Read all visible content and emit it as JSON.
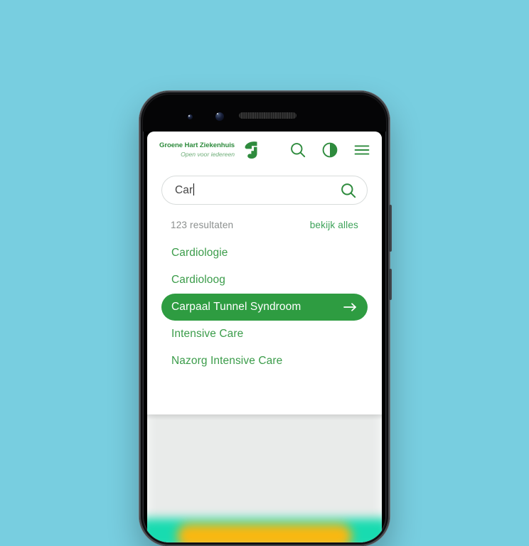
{
  "background": {
    "color": "#78cee0"
  },
  "device": {
    "name": "smartphone-mockup",
    "frame_color": "#1b1b1d",
    "buttons": [
      "volume-rocker",
      "power-button"
    ],
    "front_elements": [
      "camera-lens-small",
      "camera-lens-large",
      "earpiece-speaker"
    ]
  },
  "app": {
    "header": {
      "brand": {
        "name": "Groene Hart Ziekenhuis",
        "tagline": "Open voor iedereen",
        "mark_icon": "logo-mark-icon",
        "color": "#2e8b3d"
      },
      "actions": [
        {
          "icon": "search-icon",
          "label": "Zoeken"
        },
        {
          "icon": "contrast-icon",
          "label": "Contrast"
        },
        {
          "icon": "hamburger-menu-icon",
          "label": "Menu"
        }
      ]
    },
    "search": {
      "value": "Car",
      "placeholder": "Zoeken",
      "submit_icon": "search-icon",
      "has_caret": true
    },
    "results": {
      "count_label": "123 resultaten",
      "view_all_label": "bekijk alles",
      "accent_color": "#3ea35a",
      "items": [
        {
          "label": "Cardiologie",
          "selected": false
        },
        {
          "label": "Cardioloog",
          "selected": false
        },
        {
          "label": "Carpaal Tunnel Syndroom",
          "selected": true,
          "arrow_icon": "arrow-right-icon"
        },
        {
          "label": "Intensive Care",
          "selected": false
        },
        {
          "label": "Nazorg Intensive Care",
          "selected": false
        }
      ]
    },
    "background_page": {
      "state": "blurred",
      "card_color": "#f1f3f2",
      "band_color": "#18dbb0",
      "cta_color": "#f9b811"
    }
  }
}
